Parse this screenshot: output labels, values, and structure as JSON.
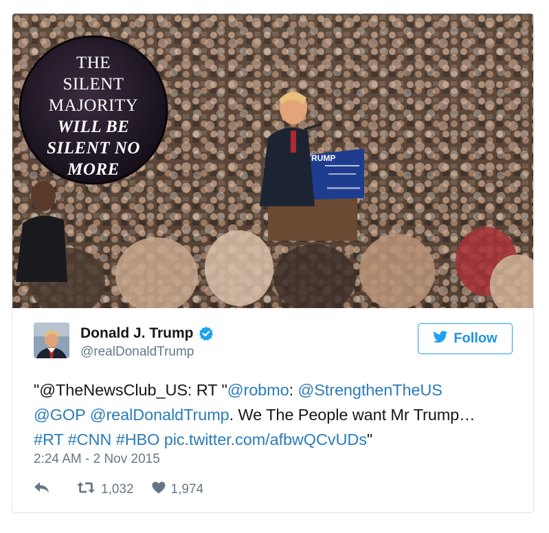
{
  "badge": {
    "line1": "THE",
    "line2": "SILENT",
    "line3": "MAJORITY",
    "line4": "WILL BE",
    "line5": "SILENT NO",
    "line6": "MORE"
  },
  "podium": {
    "sign_text": "TRUMP"
  },
  "author": {
    "display_name": "Donald J. Trump",
    "handle": "@realDonaldTrump",
    "verified": true
  },
  "follow_button": {
    "label": "Follow",
    "icon": "twitter-bird-icon"
  },
  "tweet": {
    "text_open": "\"@TheNewsClub_US: RT \"",
    "mention_robmo": "@robmo",
    "text_colon": ": ",
    "mention_strengthen": "@StrengthenTheUS",
    "mention_gop": "@GOP",
    "mention_trump": "@realDonaldTrump",
    "text_body": ". We The People want Mr Trump…",
    "hashtag_rt": "#RT",
    "hashtag_cnn": "#CNN",
    "hashtag_hbo": "#HBO",
    "link": "pic.twitter.com/afbwQCvUDs",
    "text_close": "\""
  },
  "timestamp": "2:24 AM - 2 Nov 2015",
  "actions": {
    "reply_icon": "reply-icon",
    "retweet_icon": "retweet-icon",
    "retweet_count": "1,032",
    "like_icon": "heart-icon",
    "like_count": "1,974"
  },
  "colors": {
    "link": "#2b7bb9",
    "follow_border": "#1da1f2",
    "secondary_text": "#657786",
    "verified_blue": "#1da1f2"
  }
}
